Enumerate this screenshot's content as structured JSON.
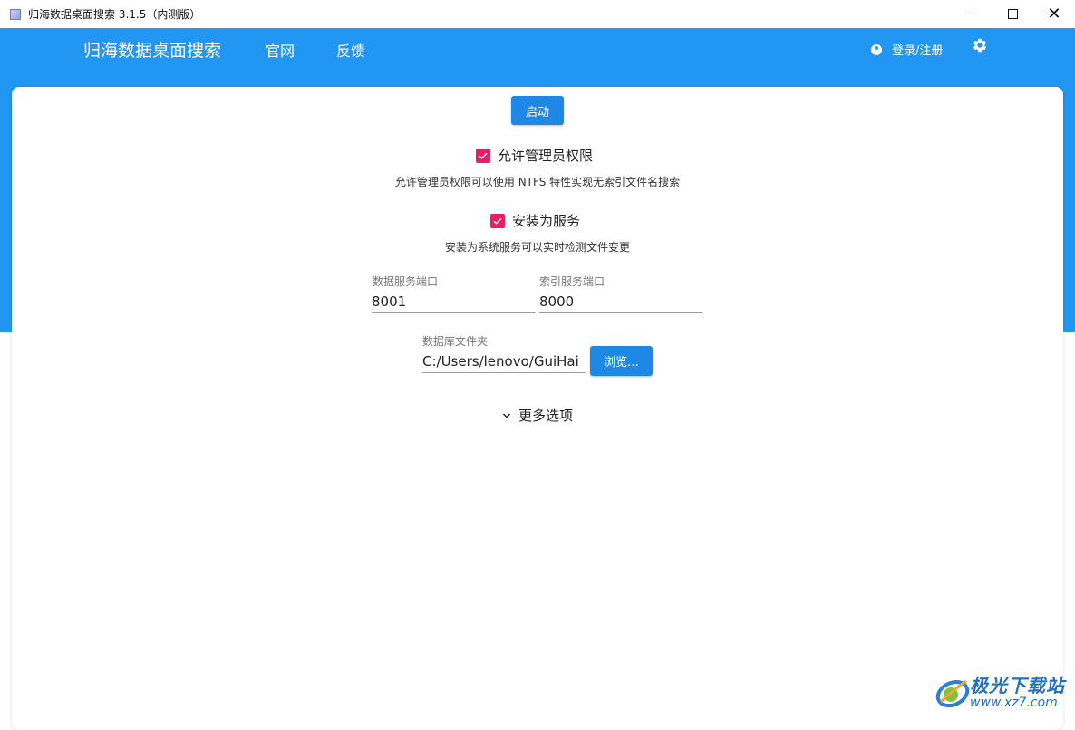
{
  "window": {
    "title": "归海数据桌面搜索 3.1.5（内测版）",
    "minimize_icon": "minimize-icon",
    "maximize_icon": "maximize-icon",
    "close_glyph": "✕"
  },
  "header": {
    "brand": "归海数据桌面搜索",
    "nav": [
      "官网",
      "反馈"
    ],
    "login_label": "登录/注册",
    "login_icon": "user-icon",
    "settings_icon": "gear-icon"
  },
  "colors": {
    "primary": "#2196f3",
    "button": "#1e88e5",
    "checkbox": "#e91e63"
  },
  "main": {
    "start_label": "启动",
    "admin": {
      "label": "允许管理员权限",
      "checked": true,
      "hint": "允许管理员权限可以使用 NTFS 特性实现无索引文件名搜索"
    },
    "service": {
      "label": "安装为服务",
      "checked": true,
      "hint": "安装为系统服务可以实时检测文件变更"
    },
    "data_port": {
      "label": "数据服务端口",
      "value": "8001"
    },
    "index_port": {
      "label": "索引服务端口",
      "value": "8000"
    },
    "db_folder": {
      "label": "数据库文件夹",
      "value": "C:/Users/lenovo/GuiHai"
    },
    "browse_label": "浏览...",
    "more_options": "更多选项"
  },
  "watermark": {
    "title": "极光下载站",
    "url": "www.xz7.com"
  }
}
